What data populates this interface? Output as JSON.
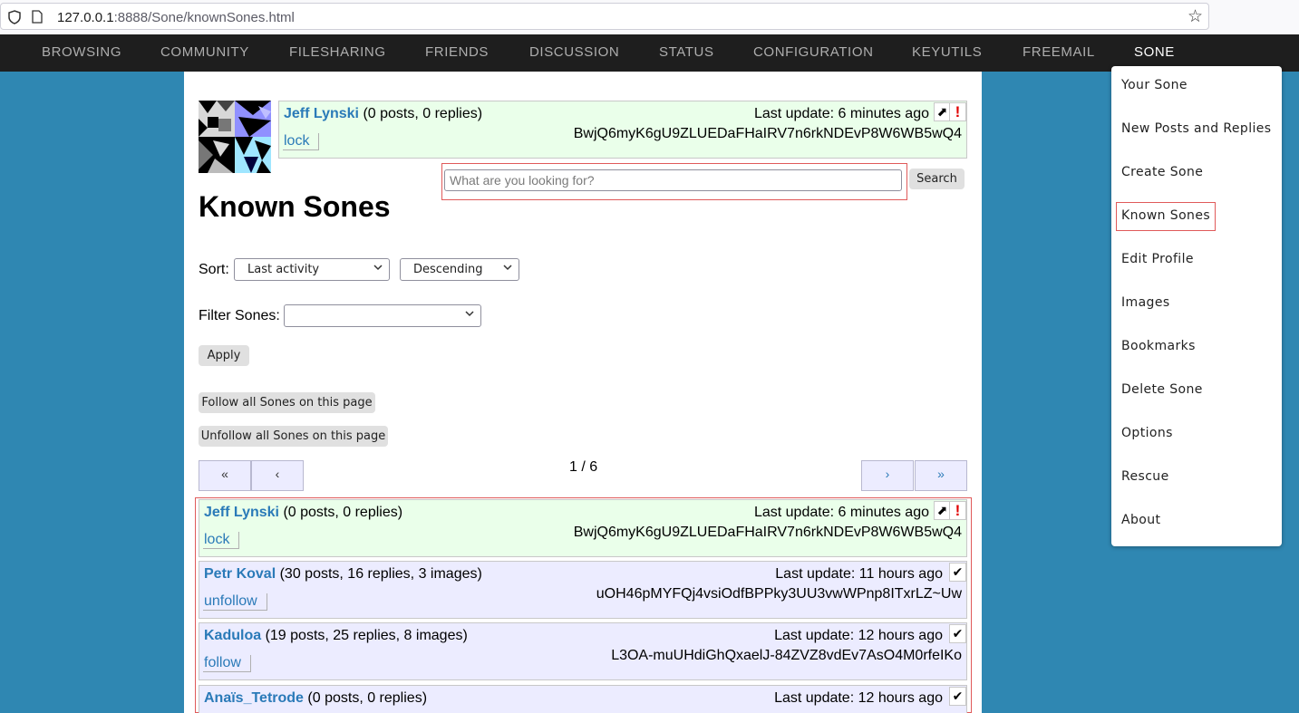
{
  "browser": {
    "url_host": "127.0.0.1",
    "url_path": ":8888/Sone/knownSones.html"
  },
  "topnav": {
    "items": [
      "BROWSING",
      "COMMUNITY",
      "FILESHARING",
      "FRIENDS",
      "DISCUSSION",
      "STATUS",
      "CONFIGURATION",
      "KEYUTILS",
      "FREEMAIL",
      "SONE"
    ],
    "active": "SONE"
  },
  "current_sone": {
    "name": "Jeff Lynski",
    "stats": "(0 posts, 0 replies)",
    "last_update": "Last update: 6 minutes ago",
    "id": "BwjQ6myK6gU9ZLUEDaFHaIRV7n6rkNDEvP8W6WB5wQ4",
    "action": "lock",
    "badge_icons": [
      "arrow-icon",
      "warning-icon"
    ]
  },
  "search": {
    "placeholder": "What are you looking for?",
    "button": "Search"
  },
  "page": {
    "title": "Known Sones",
    "sort_label": "Sort:",
    "sort_by": "Last activity",
    "sort_order": "Descending",
    "filter_label": "Filter Sones:",
    "filter_value": "",
    "apply": "Apply",
    "follow_all": "Follow all Sones on this page",
    "unfollow_all": "Unfollow all Sones on this page"
  },
  "pager": {
    "first": "«",
    "prev": "‹",
    "info": "1 / 6",
    "next": "›",
    "last": "»"
  },
  "sones": [
    {
      "name": "Jeff Lynski",
      "stats": "(0 posts, 0 replies)",
      "last_update": "Last update: 6 minutes ago",
      "id": "BwjQ6myK6gU9ZLUEDaFHaIRV7n6rkNDEvP8W6WB5wQ4",
      "action": "lock",
      "badges": [
        "⬈",
        "!"
      ]
    },
    {
      "name": "Petr Koval",
      "stats": "(30 posts, 16 replies, 3 images)",
      "last_update": "Last update: 11 hours ago",
      "id": "uOH46pMYFQj4vsiOdfBPPky3UU3vwWPnp8ITxrLZ~Uw",
      "action": "unfollow",
      "badges": [
        "✔"
      ]
    },
    {
      "name": "Kaduloa",
      "stats": "(19 posts, 25 replies, 8 images)",
      "last_update": "Last update: 12 hours ago",
      "id": "L3OA-muUHdiGhQxaelJ-84ZVZ8vdEv7AsO4M0rfeIKo",
      "action": "follow",
      "badges": [
        "✔"
      ]
    },
    {
      "name": "Anaïs_Tetrode",
      "stats": "(0 posts, 0 replies)",
      "last_update": "Last update: 12 hours ago",
      "id": "",
      "action": "",
      "badges": [
        "✔"
      ]
    }
  ],
  "menu": {
    "items": [
      "Your Sone",
      "New Posts and Replies",
      "Create Sone",
      "Known Sones",
      "Edit Profile",
      "Images",
      "Bookmarks",
      "Delete Sone",
      "Options",
      "Rescue",
      "About"
    ],
    "active": "Known Sones"
  },
  "colors": {
    "page_bg": "#2f87b2",
    "nav_bg": "#1e1e1e",
    "own_sone_bg": "#eaffea",
    "sone_bg": "#ececff",
    "link": "#2a7ab8",
    "highlight": "#e05a5a"
  }
}
